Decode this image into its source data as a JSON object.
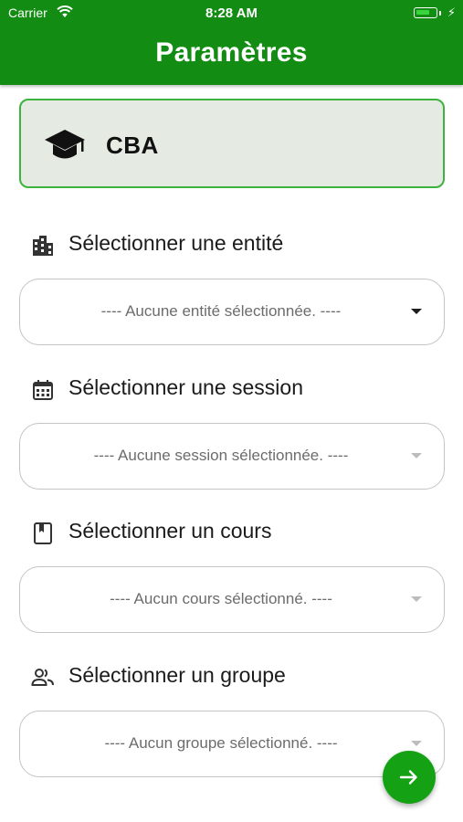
{
  "status_bar": {
    "carrier": "Carrier",
    "time": "8:28 AM"
  },
  "header": {
    "title": "Paramètres",
    "background_color": "#128c12"
  },
  "school": {
    "name": "CBA",
    "icon": "graduation-cap-icon"
  },
  "fields": [
    {
      "label": "Sélectionner une entité",
      "icon": "building-icon",
      "value": "---- Aucune entité sélectionnée. ----",
      "enabled": true
    },
    {
      "label": "Sélectionner une session",
      "icon": "calendar-icon",
      "value": "---- Aucune session sélectionnée. ----",
      "enabled": false
    },
    {
      "label": "Sélectionner un cours",
      "icon": "book-icon",
      "value": "---- Aucun cours sélectionné. ----",
      "enabled": false
    },
    {
      "label": "Sélectionner un groupe",
      "icon": "group-icon",
      "value": "---- Aucun groupe sélectionné. ----",
      "enabled": false
    }
  ],
  "next_button": {
    "icon": "arrow-right-icon",
    "color": "#14a114"
  }
}
